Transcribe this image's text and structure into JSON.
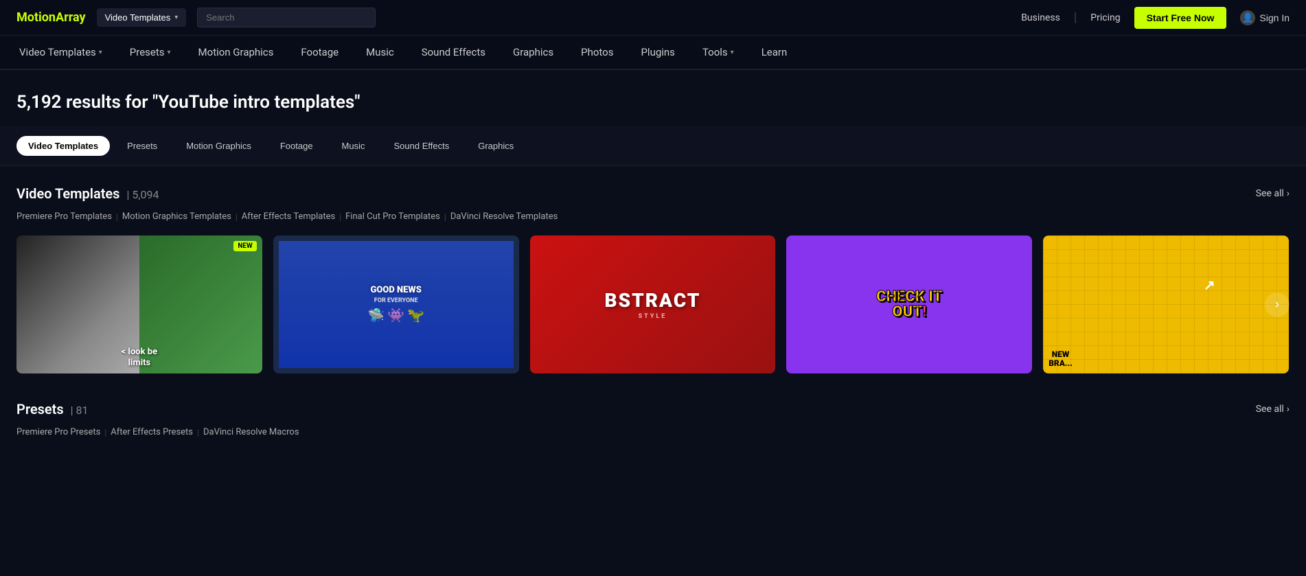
{
  "brand": {
    "name_part1": "Motion",
    "name_part2": "Array"
  },
  "header": {
    "search_dropdown_label": "Video Templates",
    "search_placeholder": "Search",
    "business_label": "Business",
    "pricing_label": "Pricing",
    "start_free_label": "Start Free Now",
    "sign_in_label": "Sign In"
  },
  "nav": {
    "items": [
      {
        "label": "Video Templates",
        "has_chevron": true
      },
      {
        "label": "Presets",
        "has_chevron": true
      },
      {
        "label": "Motion Graphics",
        "has_chevron": false
      },
      {
        "label": "Footage",
        "has_chevron": false
      },
      {
        "label": "Music",
        "has_chevron": false
      },
      {
        "label": "Sound Effects",
        "has_chevron": false
      },
      {
        "label": "Graphics",
        "has_chevron": false
      },
      {
        "label": "Photos",
        "has_chevron": false
      },
      {
        "label": "Plugins",
        "has_chevron": false
      },
      {
        "label": "Tools",
        "has_chevron": true
      },
      {
        "label": "Learn",
        "has_chevron": false
      }
    ]
  },
  "results": {
    "count_text": "5,192 results for \"YouTube intro templates\""
  },
  "filter_tabs": [
    {
      "label": "Video Templates",
      "active": true
    },
    {
      "label": "Presets",
      "active": false
    },
    {
      "label": "Motion Graphics",
      "active": false
    },
    {
      "label": "Footage",
      "active": false
    },
    {
      "label": "Music",
      "active": false
    },
    {
      "label": "Sound Effects",
      "active": false
    },
    {
      "label": "Graphics",
      "active": false
    }
  ],
  "video_templates_section": {
    "title": "Video Templates",
    "count": "5,094",
    "see_all": "See all",
    "sub_links": [
      "Premiere Pro Templates",
      "Motion Graphics Templates",
      "After Effects Templates",
      "Final Cut Pro Templates",
      "DaVinci Resolve Templates"
    ],
    "cards": [
      {
        "id": "card1",
        "type": "bw_green",
        "badge": "NEW",
        "text_line1": "< look be",
        "text_line2": "limits"
      },
      {
        "id": "card2",
        "type": "goodnews",
        "title": "GOOD NEWS",
        "subtitle": "FOR EVERYONE"
      },
      {
        "id": "card3",
        "type": "abstract",
        "text": "BSTRACT",
        "sub": "STYLE"
      },
      {
        "id": "card4",
        "type": "checkit",
        "text_line1": "CHECK IT",
        "text_line2": "OUT!"
      },
      {
        "id": "card5",
        "type": "yellow_grid",
        "text_line1": "NEW",
        "text_line2": "BRA..."
      }
    ]
  },
  "presets_section": {
    "title": "Presets",
    "count": "81",
    "see_all": "See all",
    "sub_links": [
      "Premiere Pro Presets",
      "After Effects Presets",
      "DaVinci Resolve Macros"
    ]
  }
}
